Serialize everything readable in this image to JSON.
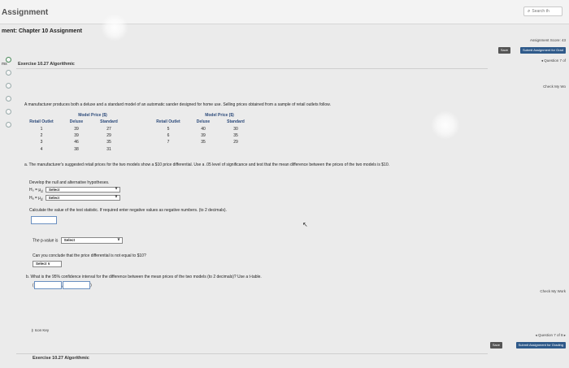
{
  "header": {
    "app_title": "Assignment",
    "search_placeholder": "Search th",
    "assignment_title": "ment: Chapter 10 Assignment"
  },
  "right_panel": {
    "assignment_score": "Assignment Score: 43",
    "save": "Save",
    "submit": "Submit Assignment for Grad",
    "question_nav": "◂ Question 7 of",
    "check_my_work": "Check My Wo",
    "check_my_work_2": "Check My Work",
    "question_nav_2": "◂ Question 7 of 8 ▸",
    "save_2": "Save",
    "submit_2": "Submit Assignment for Grading"
  },
  "left_label": "ms",
  "exercise": {
    "title": "Exercise 10.27 Algorithmic",
    "bottom_title": "Exercise 10.27 Algorithmic"
  },
  "question": {
    "intro": "A manufacturer produces both a deluxe and a standard model of an automatic sander designed for home use. Selling prices obtained from a sample of retail outlets follow.",
    "table_left": {
      "group_header": "Model Price ($)",
      "col_outlet": "Retail Outlet",
      "col_deluxe": "Deluxe",
      "col_standard": "Standard",
      "rows": [
        [
          "1",
          "39",
          "27"
        ],
        [
          "2",
          "39",
          "29"
        ],
        [
          "3",
          "46",
          "35"
        ],
        [
          "4",
          "38",
          "31"
        ]
      ]
    },
    "table_right": {
      "group_header": "Model Price ($)",
      "col_outlet": "Retail Outlet",
      "col_deluxe": "Deluxe",
      "col_standard": "Standard",
      "rows": [
        [
          "5",
          "40",
          "30"
        ],
        [
          "6",
          "39",
          "35"
        ],
        [
          "7",
          "35",
          "29"
        ]
      ]
    },
    "part_a": "a. The manufacturer's suggested retail prices for the two models show a $10 price differential. Use a .05 level of significance and test that the mean difference between the prices of the two models is $10.",
    "develop": "Develop the null and alternative hypotheses.",
    "h0": "H₀ = μ",
    "ha": "Hₐ = μ",
    "hyp_sub": "d",
    "select": "Select",
    "calc": "Calculate the value of the test statistic. If required enter negative values as negative numbers. (to 2 decimals).",
    "pvalue_label": "The p-value is",
    "can_conclude": "Can you conclude that the price differential is not equal to $10?",
    "part_b": "b. What is the 95% confidence interval for the difference between the mean prices of the two models (to 2 decimals)? Use a t-table.",
    "ci_open": "(",
    "ci_comma": ",",
    "ci_close": ")"
  },
  "icon_key": "Icon Key"
}
